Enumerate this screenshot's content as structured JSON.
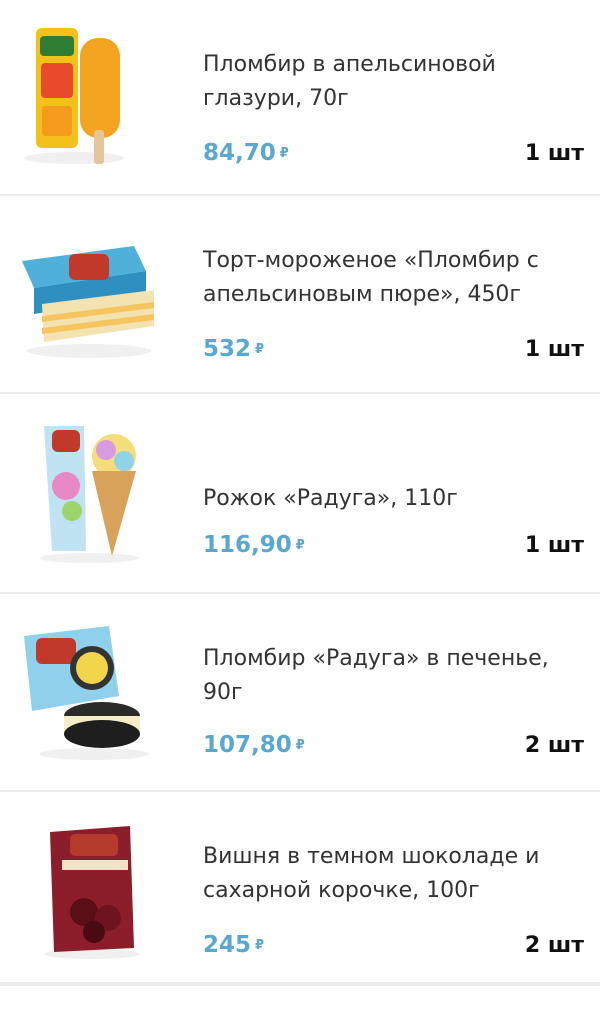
{
  "currency_symbol": "₽",
  "items": [
    {
      "title": "Пломбир в апельсиновой глазури, 70г",
      "price": "84,70",
      "qty": "1 шт",
      "image": "orange-glazed-ice-cream-bar"
    },
    {
      "title": "Торт-мороженое «Пломбир с апельсиновым пюре», 450г",
      "price": "532",
      "qty": "1 шт",
      "image": "ice-cream-cake-box"
    },
    {
      "title": "Рожок «Радуга», 110г",
      "price": "116,90",
      "qty": "1 шт",
      "image": "rainbow-cone"
    },
    {
      "title": "Пломбир «Радуга» в печенье, 90г",
      "price": "107,80",
      "qty": "2 шт",
      "image": "ice-cream-sandwich"
    },
    {
      "title": "Вишня в темном шоколаде и сахарной корочке, 100г",
      "price": "245",
      "qty": "2 шт",
      "image": "cherry-chocolate-pack"
    }
  ],
  "colors": {
    "price": "#5aa7cf",
    "divider": "#ececec"
  }
}
